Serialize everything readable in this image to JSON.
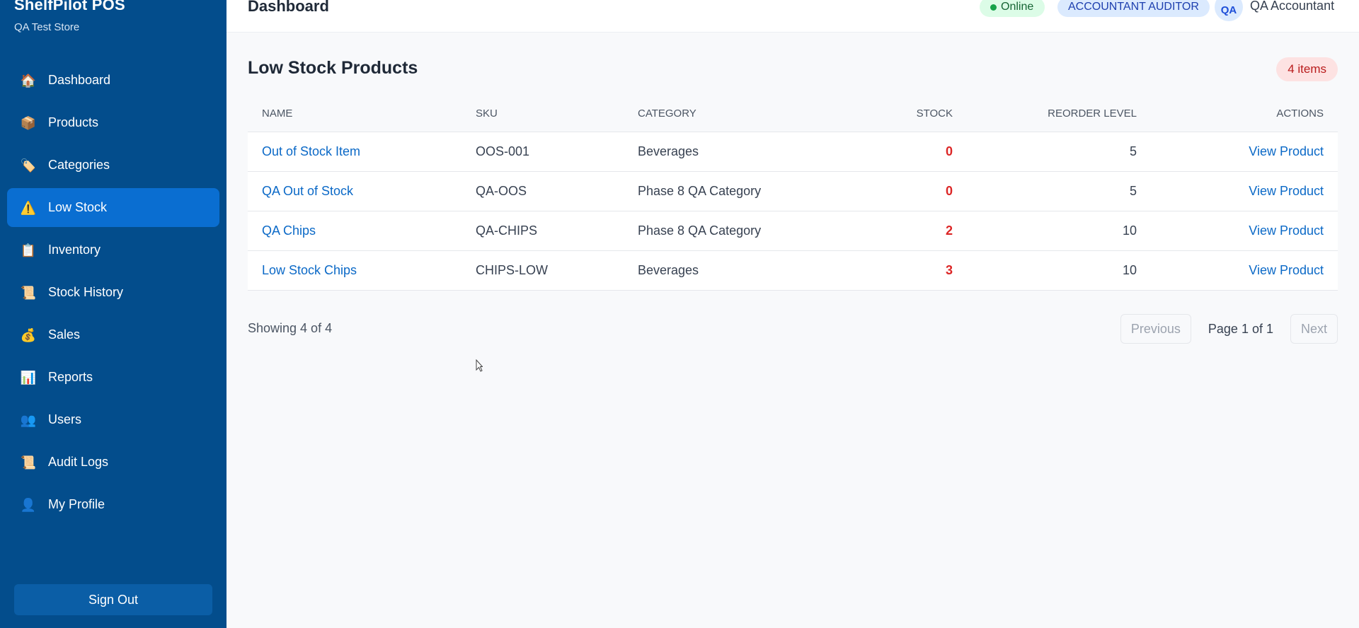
{
  "sidebar": {
    "brand": "ShelfPilot POS",
    "store": "QA Test Store",
    "items": [
      {
        "label": "Dashboard",
        "icon": "🏠",
        "active": false
      },
      {
        "label": "Products",
        "icon": "📦",
        "active": false
      },
      {
        "label": "Categories",
        "icon": "🏷️",
        "active": false
      },
      {
        "label": "Low Stock",
        "icon": "⚠️",
        "active": true
      },
      {
        "label": "Inventory",
        "icon": "📋",
        "active": false
      },
      {
        "label": "Stock History",
        "icon": "📜",
        "active": false
      },
      {
        "label": "Sales",
        "icon": "💰",
        "active": false
      },
      {
        "label": "Reports",
        "icon": "📊",
        "active": false
      },
      {
        "label": "Users",
        "icon": "👥",
        "active": false
      },
      {
        "label": "Audit Logs",
        "icon": "📜",
        "active": false
      },
      {
        "label": "My Profile",
        "icon": "👤",
        "active": false
      }
    ],
    "sign_out": "Sign Out"
  },
  "header": {
    "title": "Dashboard",
    "status": "Online",
    "role": "ACCOUNTANT AUDITOR",
    "avatar_initials": "QA",
    "user_name": "QA Accountant"
  },
  "main": {
    "title": "Low Stock Products",
    "count_badge": "4 items",
    "columns": {
      "name": "NAME",
      "sku": "SKU",
      "category": "CATEGORY",
      "stock": "STOCK",
      "reorder": "REORDER LEVEL",
      "actions": "ACTIONS"
    },
    "rows": [
      {
        "name": "Out of Stock Item",
        "sku": "OOS-001",
        "category": "Beverages",
        "stock": "0",
        "reorder": "5",
        "action": "View Product"
      },
      {
        "name": "QA Out of Stock",
        "sku": "QA-OOS",
        "category": "Phase 8 QA Category",
        "stock": "0",
        "reorder": "5",
        "action": "View Product"
      },
      {
        "name": "QA Chips",
        "sku": "QA-CHIPS",
        "category": "Phase 8 QA Category",
        "stock": "2",
        "reorder": "10",
        "action": "View Product"
      },
      {
        "name": "Low Stock Chips",
        "sku": "CHIPS-LOW",
        "category": "Beverages",
        "stock": "3",
        "reorder": "10",
        "action": "View Product"
      }
    ],
    "showing": "Showing 4 of 4",
    "pagination": {
      "previous": "Previous",
      "page_info": "Page 1 of 1",
      "next": "Next"
    }
  },
  "colors": {
    "sidebar_bg": "#034d8c",
    "active_item": "#0a6ed1",
    "link": "#0b69c7",
    "stock_alert": "#dc2626"
  }
}
